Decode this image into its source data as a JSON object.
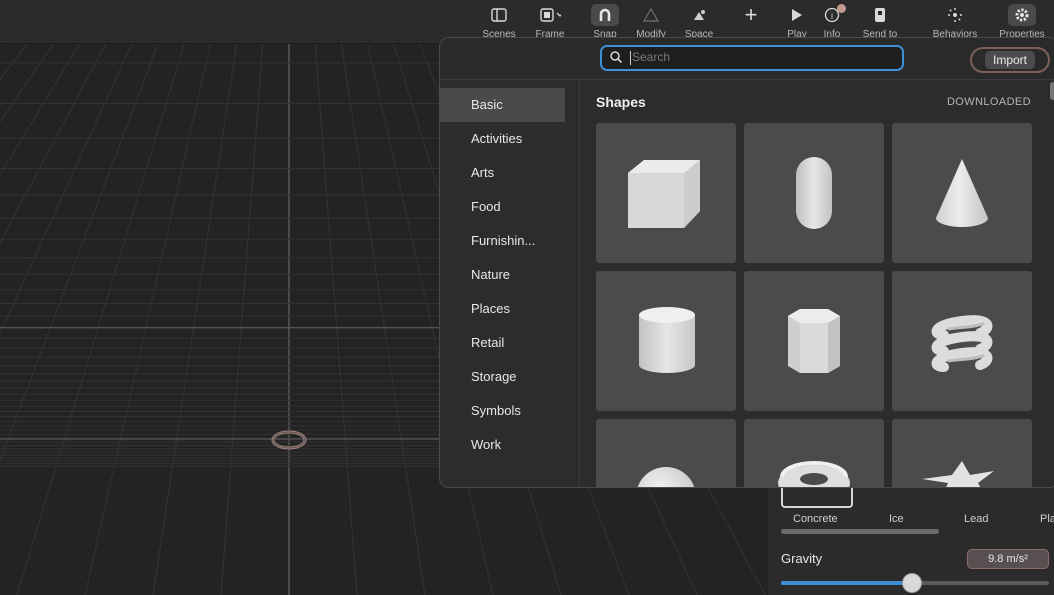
{
  "toolbar": {
    "items": [
      {
        "label": "Scenes",
        "icon": "sidebar-icon"
      },
      {
        "label": "Frame",
        "icon": "frame-icon"
      },
      {
        "label": "Snap",
        "icon": "magnet-icon"
      },
      {
        "label": "Modify",
        "icon": "modify-icon"
      },
      {
        "label": "Space",
        "icon": "space-icon"
      },
      {
        "label": "",
        "icon": "plus-icon"
      },
      {
        "label": "Play",
        "icon": "play-icon"
      },
      {
        "label": "Info",
        "icon": "info-icon"
      },
      {
        "label": "Send to",
        "icon": "send-to-icon"
      },
      {
        "label": "Behaviors",
        "icon": "behaviors-icon"
      },
      {
        "label": "Properties",
        "icon": "gear-icon"
      }
    ]
  },
  "popover": {
    "search_placeholder": "Search",
    "import_label": "Import",
    "categories": [
      "Basic",
      "Activities",
      "Arts",
      "Food",
      "Furnishin...",
      "Nature",
      "Places",
      "Retail",
      "Storage",
      "Symbols",
      "Work"
    ],
    "selected_category": "Basic",
    "section_title": "Shapes",
    "downloaded_label": "DOWNLOADED",
    "shapes": [
      "cube",
      "capsule",
      "cone",
      "cylinder",
      "hexagonal-prism",
      "spring",
      "sphere",
      "torus",
      "star"
    ]
  },
  "properties": {
    "materials": [
      "Concrete",
      "Ice",
      "Lead",
      "Pla"
    ],
    "gravity_label": "Gravity",
    "gravity_value": "9.8 m/s²",
    "gravity_slider_fraction": 0.49
  },
  "colors": {
    "accent": "#3d8fd6",
    "import_ring": "#7c5f59",
    "notification": "#c59a90"
  }
}
